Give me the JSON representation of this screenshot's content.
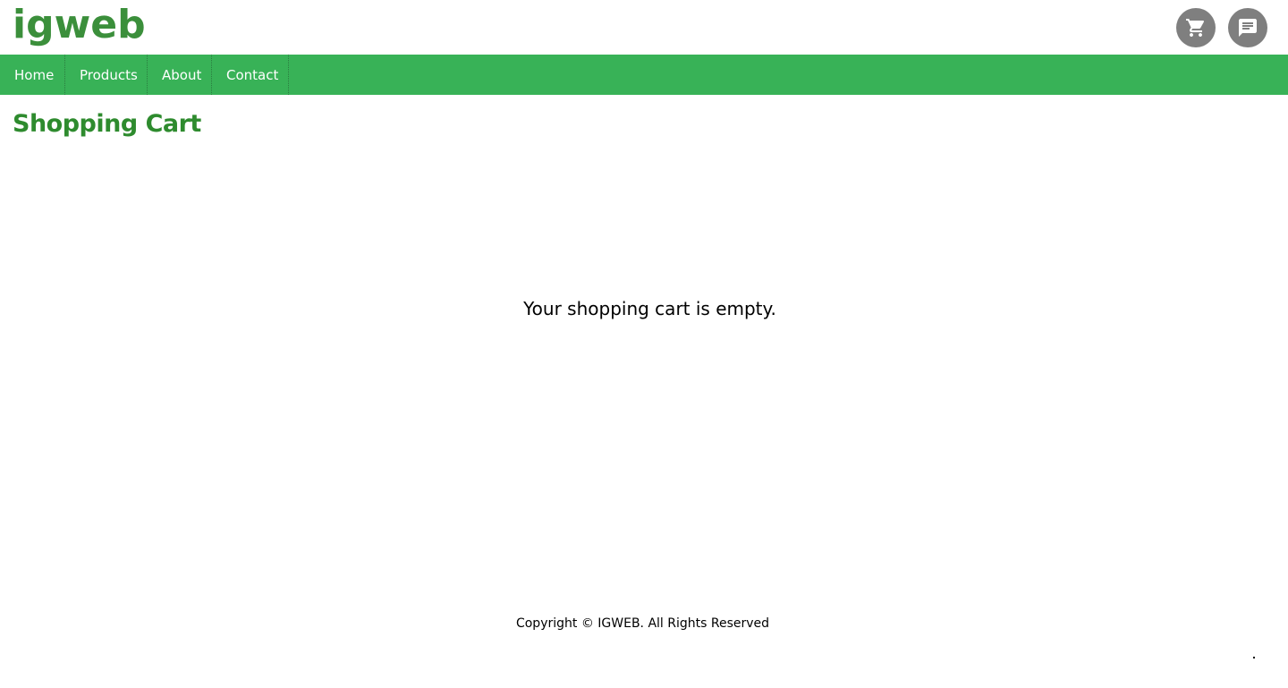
{
  "header": {
    "logo_text": "igweb",
    "cart_icon": "shopping-cart-icon",
    "chat_icon": "chat-bubble-icon"
  },
  "nav": {
    "items": [
      {
        "label": "Home"
      },
      {
        "label": "Products"
      },
      {
        "label": "About"
      },
      {
        "label": "Contact"
      }
    ]
  },
  "main": {
    "title": "Shopping Cart",
    "empty_message": "Your shopping cart is empty."
  },
  "footer": {
    "copyright": "Copyright © IGWEB. All Rights Reserved"
  },
  "colors": {
    "brand_green": "#3b8f3b",
    "nav_green": "#38b257",
    "title_green": "#2e8b2e",
    "icon_bg": "#7f7f7f"
  }
}
